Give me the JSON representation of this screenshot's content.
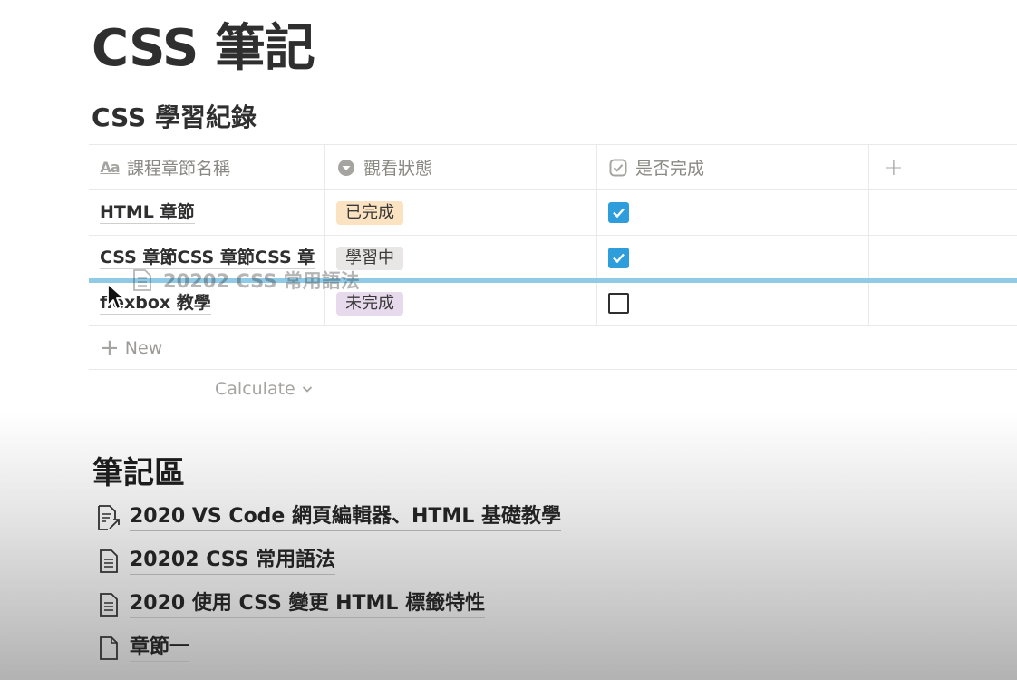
{
  "page": {
    "title": "CSS 筆記"
  },
  "database": {
    "title": "CSS 學習紀錄",
    "columns": [
      {
        "label": "課程章節名稱",
        "icon": "text-property-icon"
      },
      {
        "label": "觀看狀態",
        "icon": "select-property-icon"
      },
      {
        "label": "是否完成",
        "icon": "checkbox-property-icon"
      }
    ],
    "add_column_icon": "plus-icon",
    "rows": [
      {
        "name": "HTML 章節",
        "status": "已完成",
        "status_color": "#fbe3c1",
        "done": true
      },
      {
        "name": "CSS 章節CSS 章節CSS 章",
        "status": "學習中",
        "status_color": "#e8e7e5",
        "done": true
      },
      {
        "name": "flexbox 教學",
        "name_visible": "f xbox 教學",
        "status": "未完成",
        "status_color": "#e7daed",
        "done": false
      }
    ],
    "new_label": "New",
    "calculate_label": "Calculate"
  },
  "drag": {
    "ghost_label": "20202 CSS 常用語法",
    "drop_indicator_color": "#8fcbe6"
  },
  "notes": {
    "heading": "筆記區",
    "items": [
      {
        "label": "2020 VS Code 網頁編輯器、HTML 基礎教學",
        "icon": "page-link-icon"
      },
      {
        "label": "20202 CSS 常用語法",
        "icon": "page-text-icon"
      },
      {
        "label": "2020 使用 CSS 變更 HTML 標籤特性",
        "icon": "page-text-icon"
      },
      {
        "label": "章節一",
        "icon": "page-blank-icon"
      }
    ]
  },
  "colors": {
    "checkbox_checked": "#2e9ddb",
    "text_primary": "#2f2f2f",
    "text_muted": "#9b9a97"
  }
}
